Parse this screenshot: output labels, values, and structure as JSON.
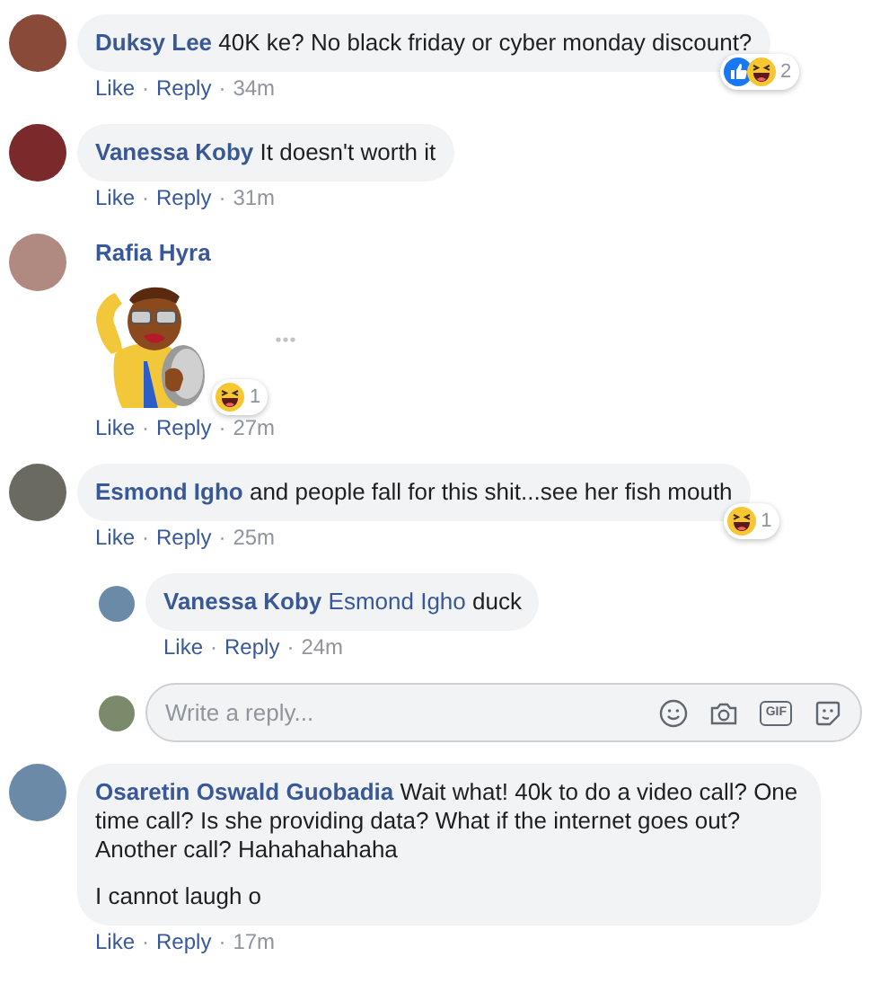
{
  "comments": [
    {
      "kind": "text",
      "author": "Duksy Lee",
      "paragraphs": [
        "40K ke? No black friday or cyber monday discount?"
      ],
      "reactions": {
        "like": true,
        "haha": true,
        "count": "2"
      },
      "actions": [
        {
          "kind": "link",
          "text": "Like"
        },
        {
          "kind": "dot",
          "text": "·"
        },
        {
          "kind": "link",
          "text": "Reply"
        },
        {
          "kind": "dot",
          "text": "·"
        },
        {
          "kind": "time",
          "text": "34m"
        }
      ]
    },
    {
      "kind": "text",
      "author": "Vanessa Koby",
      "paragraphs": [
        "It doesn't worth it"
      ],
      "actions": [
        {
          "kind": "link",
          "text": "Like"
        },
        {
          "kind": "dot",
          "text": "·"
        },
        {
          "kind": "link",
          "text": "Reply"
        },
        {
          "kind": "dot",
          "text": "·"
        },
        {
          "kind": "time",
          "text": "31m"
        }
      ]
    },
    {
      "kind": "sticker",
      "author": "Rafia Hyra",
      "reactions": {
        "like": false,
        "haha": true,
        "count": "1"
      },
      "actions": [
        {
          "kind": "link",
          "text": "Like"
        },
        {
          "kind": "dot",
          "text": "·"
        },
        {
          "kind": "link",
          "text": "Reply"
        },
        {
          "kind": "dot",
          "text": "·"
        },
        {
          "kind": "time",
          "text": "27m"
        }
      ]
    },
    {
      "kind": "text",
      "author": "Esmond Igho",
      "paragraphs": [
        "and people fall for this shit...see her fish mouth"
      ],
      "reactions": {
        "like": false,
        "haha": true,
        "count": "1"
      },
      "actions": [
        {
          "kind": "link",
          "text": "Like"
        },
        {
          "kind": "dot",
          "text": "·"
        },
        {
          "kind": "link",
          "text": "Reply"
        },
        {
          "kind": "dot",
          "text": "·"
        },
        {
          "kind": "time",
          "text": "25m"
        }
      ],
      "replies": [
        {
          "kind": "text",
          "author": "Vanessa Koby",
          "mention": "Esmond Igho",
          "paragraphs": [
            "duck"
          ],
          "actions": [
            {
              "kind": "link",
              "text": "Like"
            },
            {
              "kind": "dot",
              "text": "·"
            },
            {
              "kind": "link",
              "text": "Reply"
            },
            {
              "kind": "dot",
              "text": "·"
            },
            {
              "kind": "time",
              "text": "24m"
            }
          ]
        }
      ],
      "reply_box": {
        "placeholder": "Write a reply...",
        "gif_label": "GIF"
      }
    },
    {
      "kind": "text",
      "author": "Osaretin Oswald Guobadia",
      "paragraphs": [
        "Wait what! 40k to do a video call? One time call? Is she providing data? What if the internet goes out? Another call? Hahahahahaha",
        "I cannot laugh o"
      ],
      "actions": [
        {
          "kind": "link",
          "text": "Like"
        },
        {
          "kind": "dot",
          "text": "·"
        },
        {
          "kind": "link",
          "text": "Reply"
        },
        {
          "kind": "dot",
          "text": "·"
        },
        {
          "kind": "time",
          "text": "17m"
        }
      ]
    }
  ]
}
